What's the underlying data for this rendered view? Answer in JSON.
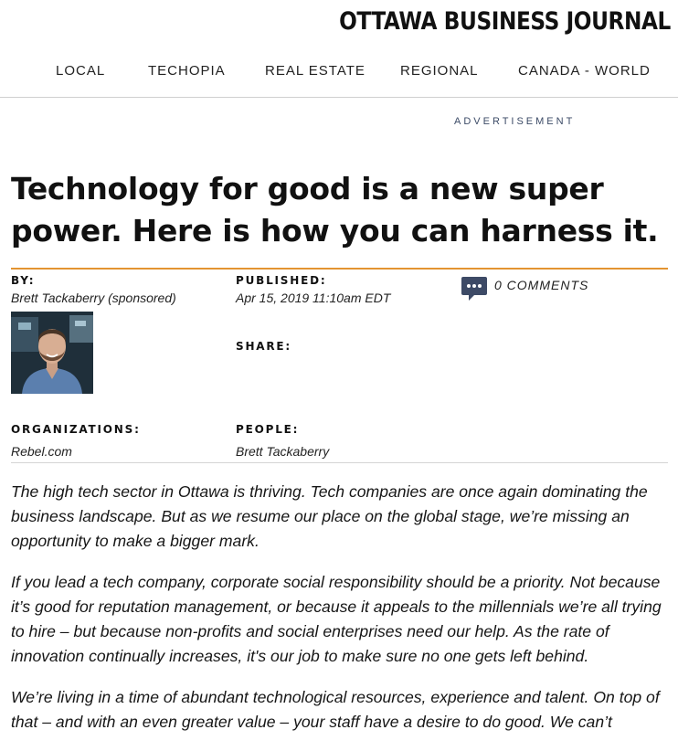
{
  "header": {
    "masthead": "OTTAWA BUSINESS JOURNAL"
  },
  "nav": {
    "items": [
      {
        "label": "LOCAL"
      },
      {
        "label": "TECHOPIA"
      },
      {
        "label": "REAL ESTATE"
      },
      {
        "label": "REGIONAL"
      },
      {
        "label": "CANADA - WORLD"
      }
    ]
  },
  "advertisement_label": "ADVERTISEMENT",
  "article": {
    "headline": "Technology for good is a new super power. Here is how you can harness it.",
    "meta": {
      "by_label": "BY:",
      "author": "Brett  Tackaberry (sponsored)",
      "published_label": "PUBLISHED:",
      "published_date": "Apr 15, 2019 11:10am EDT",
      "comments": "0 COMMENTS",
      "share_label": "SHARE:",
      "organizations_label": "ORGANIZATIONS:",
      "organizations": [
        "Rebel.com"
      ],
      "people_label": "PEOPLE:",
      "people": [
        "Brett Tackaberry"
      ]
    },
    "paragraphs": [
      "The high tech sector in Ottawa is thriving. Tech companies are once again dominating the business landscape. But as we resume our place on the global stage, we’re missing an opportunity to make a bigger mark.",
      "If you lead a tech company, corporate social responsibility should be a priority. Not because it’s good for reputation management, or because it appeals to the millennials we’re all trying to hire – but because non-profits and social enterprises need our help. As the rate of innovation continually increases, it's our job to make sure no one gets left behind.",
      "We’re living in a time of abundant technological resources, experience and talent. On top of that – and with an even greater value – your staff have a desire to do good. We can’t"
    ]
  },
  "colors": {
    "accent_rule": "#e39431",
    "comment_icon": "#3d4a66",
    "ad_label": "#3b4a66"
  }
}
